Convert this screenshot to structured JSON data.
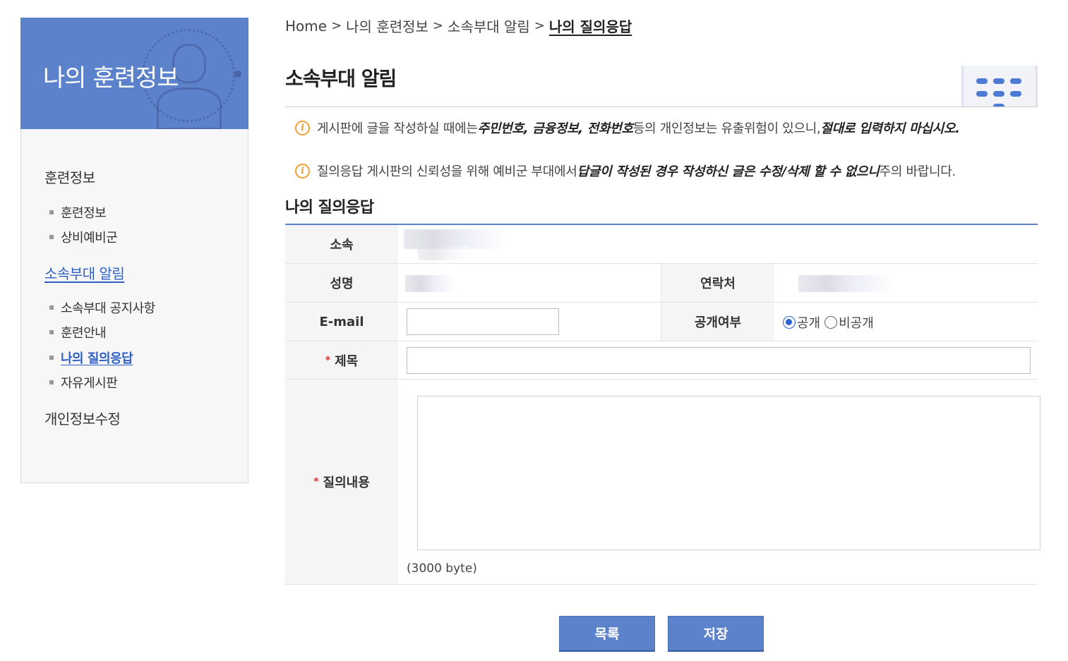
{
  "sidebar": {
    "title": "나의 훈련정보",
    "menu": [
      {
        "label": "훈련정보",
        "type": "top",
        "active": false
      },
      {
        "label": "훈련정보",
        "type": "sub",
        "active": false
      },
      {
        "label": "상비예비군",
        "type": "sub",
        "active": false
      },
      {
        "label": "소속부대 알림",
        "type": "top",
        "active": true
      },
      {
        "label": "소속부대 공지사항",
        "type": "sub",
        "active": false
      },
      {
        "label": "훈련안내",
        "type": "sub",
        "active": false
      },
      {
        "label": "나의 질의응답",
        "type": "sub",
        "active": true
      },
      {
        "label": "자유게시판",
        "type": "sub",
        "active": false
      },
      {
        "label": "개인정보수정",
        "type": "top",
        "active": false
      }
    ]
  },
  "breadcrumb": {
    "items": [
      "Home",
      "나의 훈련정보",
      "소속부대 알림",
      "나의 질의응답"
    ]
  },
  "page": {
    "title": "소속부대 알림",
    "section_title": "나의 질의응답"
  },
  "notices": {
    "n1_pre": "게시판에 글을 작성하실 때에는 ",
    "n1_bold1": "주민번호, 금융정보, 전화번호",
    "n1_mid": " 등의 개인정보는 유출위험이 있으니, ",
    "n1_bold2": "절대로 입력하지 마십시오.",
    "n2_pre": "질의응답 게시판의 신뢰성을 위해 예비군 부대에서 ",
    "n2_bold": "답글이 작성된 경우 작성하신 글은 수정/삭제 할 수 없으니",
    "n2_post": " 주의 바랍니다.",
    "icon": "info-icon"
  },
  "form": {
    "affiliation_label": "소속",
    "name_label": "성명",
    "contact_label": "연락처",
    "email_label": "E-mail",
    "email_value": "",
    "visibility_label": "공개여부",
    "visibility_options": [
      "공개",
      "비공개"
    ],
    "visibility_selected": "공개",
    "subject_label": "제목",
    "subject_value": "",
    "content_label": "질의내용",
    "content_value": "",
    "required_mark": "*",
    "byte_note": "(3000 byte)"
  },
  "buttons": {
    "list_label": "목록",
    "save_label": "저장"
  },
  "colors": {
    "accent": "#5b82ca",
    "link_active": "#2d5fc4",
    "required": "#e03333",
    "info": "#f0a030"
  }
}
